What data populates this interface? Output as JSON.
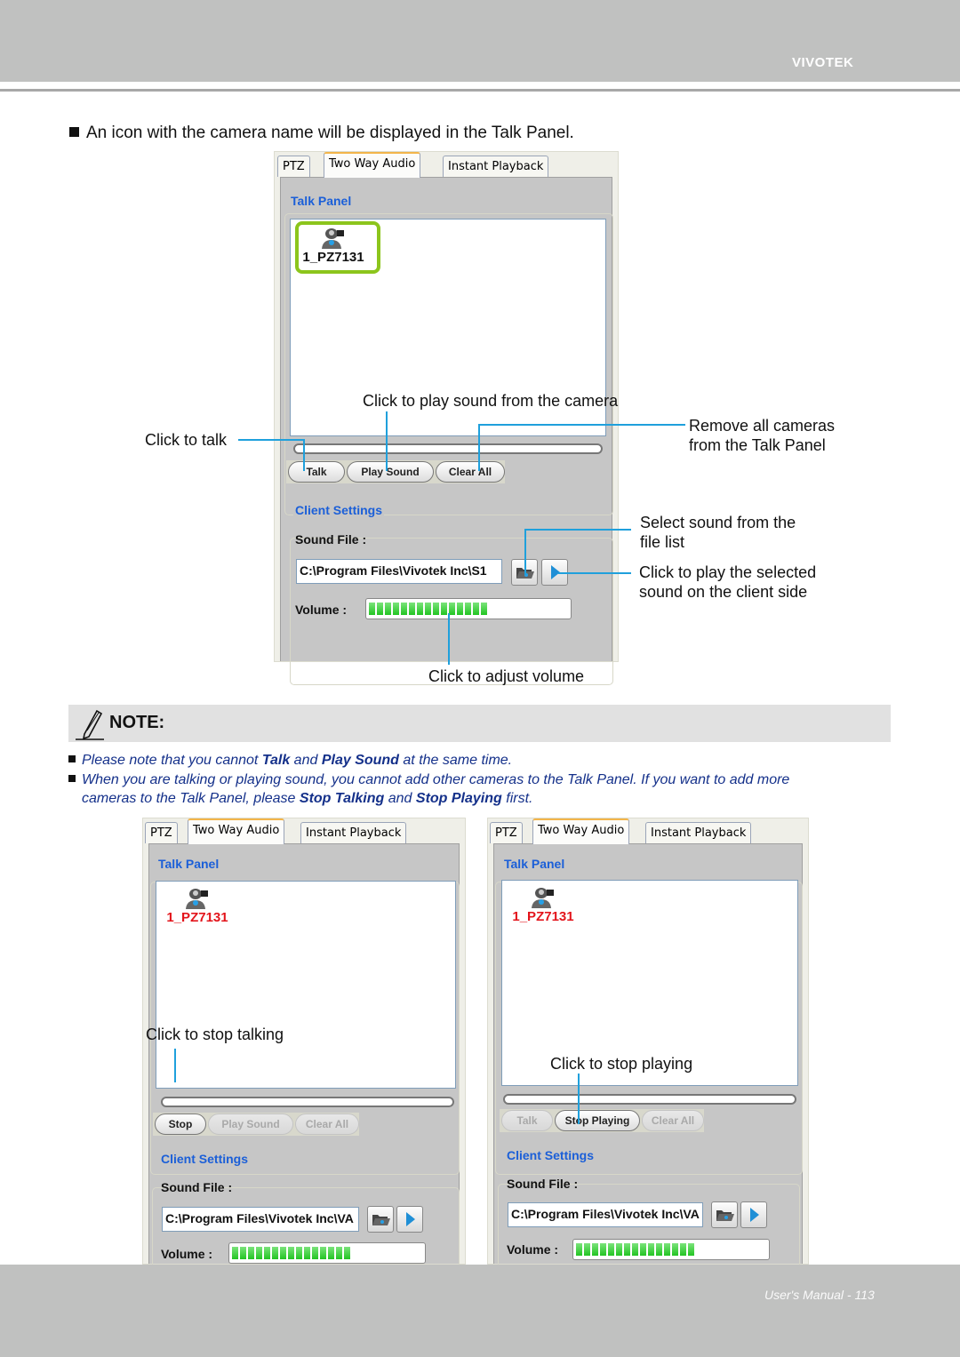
{
  "header": {
    "brand": "VIVOTEK"
  },
  "footer": {
    "page_label": "User's Manual - 113"
  },
  "intro": "An icon with the camera name will be displayed in the Talk Panel.",
  "colors": {
    "accent_blue": "#1b5fd8",
    "callout_line": "#1fa0dc",
    "highlight_green": "#8cc51c",
    "active_cam_red": "#e3141b",
    "note_text": "#14308a"
  },
  "screens": [
    {
      "tabs": [
        "PTZ",
        "Two Way Audio",
        "Instant Playback"
      ],
      "active_tab": "Two Way Audio",
      "talk_panel_legend": "Talk Panel",
      "camera_name": "1_PZ7131",
      "buttons": [
        "Talk",
        "Play Sound",
        "Clear All"
      ],
      "client_settings_legend": "Client Settings",
      "sound_file_label": "Sound File :",
      "sound_file_value": "C:\\Program Files\\Vivotek Inc\\S1",
      "volume_label": "Volume :",
      "volume_level_segments": 15,
      "icons": [
        "camera-user-icon",
        "folder-open-icon",
        "play-icon"
      ]
    },
    {
      "tabs": [
        "PTZ",
        "Two Way Audio",
        "Instant Playback"
      ],
      "talk_panel_legend": "Talk Panel",
      "camera_name": "1_PZ7131",
      "buttons": [
        "Stop",
        "Play Sound",
        "Clear All"
      ],
      "client_settings_legend": "Client Settings",
      "sound_file_label": "Sound File :",
      "sound_file_value": "C:\\Program Files\\Vivotek Inc\\VA",
      "volume_label": "Volume :",
      "volume_level_segments": 15
    },
    {
      "tabs": [
        "PTZ",
        "Two Way Audio",
        "Instant Playback"
      ],
      "talk_panel_legend": "Talk Panel",
      "camera_name": "1_PZ7131",
      "buttons": [
        "Talk",
        "Stop Playing",
        "Clear All"
      ],
      "client_settings_legend": "Client Settings",
      "sound_file_label": "Sound File :",
      "sound_file_value": "C:\\Program Files\\Vivotek Inc\\VA",
      "volume_label": "Volume :",
      "volume_level_segments": 15
    }
  ],
  "callouts": {
    "play_from_camera": "Click to play sound from the camera",
    "click_to_talk": "Click to talk",
    "remove_all": [
      "Remove all cameras",
      "from the Talk Panel"
    ],
    "select_sound": [
      "Select sound from the",
      "file list"
    ],
    "play_selected": [
      "Click to play the selected",
      "sound on the client side"
    ],
    "adjust_volume": "Click to adjust volume",
    "stop_talking": "Click to stop talking",
    "stop_playing": "Click to stop playing"
  },
  "note": {
    "title": "NOTE:",
    "item1": {
      "pre": "Please note that you cannot ",
      "b1": "Talk",
      "mid": " and ",
      "b2": "Play Sound",
      "post": " at the same time."
    },
    "item2": {
      "line1": "When you are talking or playing sound, you cannot add other cameras to the Talk Panel. If you want to add more",
      "pre": "cameras to the Talk Panel, please ",
      "b1": "Stop Talking",
      "mid": " and ",
      "b2": "Stop Playing",
      "post": " first."
    }
  }
}
